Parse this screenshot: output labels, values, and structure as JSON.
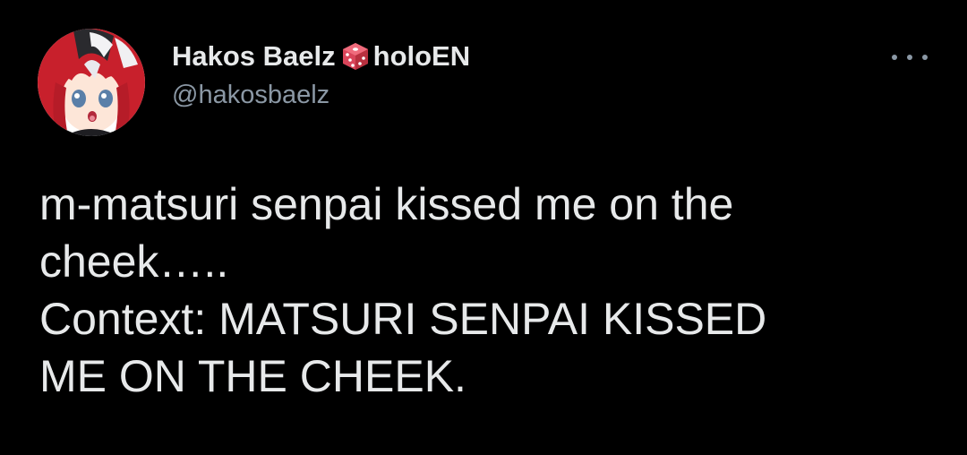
{
  "author": {
    "display_name": "Hakos Baelz",
    "badge_icon": "dice-icon",
    "affiliation": "holoEN",
    "handle": "@hakosbaelz",
    "avatar_icon": "avatar-image"
  },
  "menu": {
    "more_icon": "more-options-icon"
  },
  "tweet": {
    "line1": "m-matsuri senpai kissed me on the\ncheek…..",
    "line2": "Context: MATSURI SENPAI KISSED\nME ON THE CHEEK."
  },
  "colors": {
    "background": "#000000",
    "text_primary": "#e7e9ea",
    "text_secondary": "#8b98a5",
    "dice": "#d9455a"
  }
}
